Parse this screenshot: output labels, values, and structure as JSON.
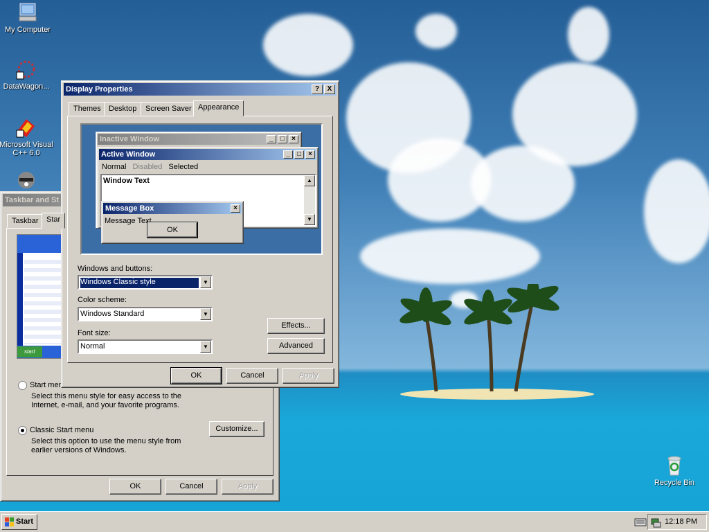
{
  "desktop": {
    "icons": [
      {
        "label": "My Computer"
      },
      {
        "label": "DataWagon..."
      },
      {
        "label": "Microsoft Visual C++ 6.0"
      },
      {
        "label": "Recycle Bin"
      }
    ]
  },
  "taskbar_props": {
    "title": "Taskbar and St",
    "tabs": [
      "Taskbar",
      "Star"
    ],
    "start_menu_option": {
      "label": "Start men",
      "description": "Select this menu style for easy access to the Internet, e-mail, and your favorite programs."
    },
    "classic_option": {
      "label": "Classic Start menu",
      "description": "Select this option to use the menu style from earlier versions of Windows."
    },
    "customize_label": "Customize...",
    "preview_start_label": "start",
    "ok_label": "OK",
    "cancel_label": "Cancel",
    "apply_label": "Apply"
  },
  "display_props": {
    "title": "Display Properties",
    "help_btn": "?",
    "close_btn": "X",
    "tabs": [
      "Themes",
      "Desktop",
      "Screen Saver",
      "Appearance"
    ],
    "preview": {
      "inactive_title": "Inactive Window",
      "active_title": "Active Window",
      "menu_normal": "Normal",
      "menu_disabled": "Disabled",
      "menu_selected": "Selected",
      "window_text": "Window Text",
      "msgbox_title": "Message Box",
      "msgbox_text": "Message Text",
      "msgbox_ok": "OK"
    },
    "windows_buttons_label": "Windows and buttons:",
    "windows_buttons_value": "Windows Classic style",
    "color_scheme_label": "Color scheme:",
    "color_scheme_value": "Windows Standard",
    "font_size_label": "Font size:",
    "font_size_value": "Normal",
    "effects_label": "Effects...",
    "advanced_label": "Advanced",
    "ok_label": "OK",
    "cancel_label": "Cancel",
    "apply_label": "Apply"
  },
  "taskbar": {
    "start_label": "Start",
    "clock": "12:18 PM"
  },
  "colors": {
    "active_title": "#0a246a",
    "inactive_title": "#808080",
    "face": "#d4d0c8"
  }
}
